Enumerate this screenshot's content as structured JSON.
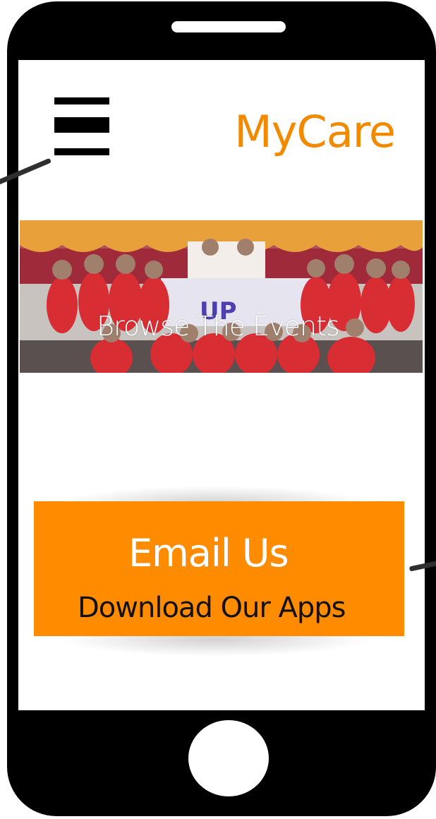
{
  "header": {
    "brand": "MyCare",
    "menu_icon": "hamburger-menu-icon"
  },
  "banner": {
    "caption": "Browse The Events",
    "image_subject": "group photo"
  },
  "cta": {
    "email_label": "Email Us",
    "download_label": "Download Our Apps"
  },
  "colors": {
    "brand": "#f28a00",
    "cta_background": "#ff8c00",
    "phone_frame": "#000000"
  }
}
